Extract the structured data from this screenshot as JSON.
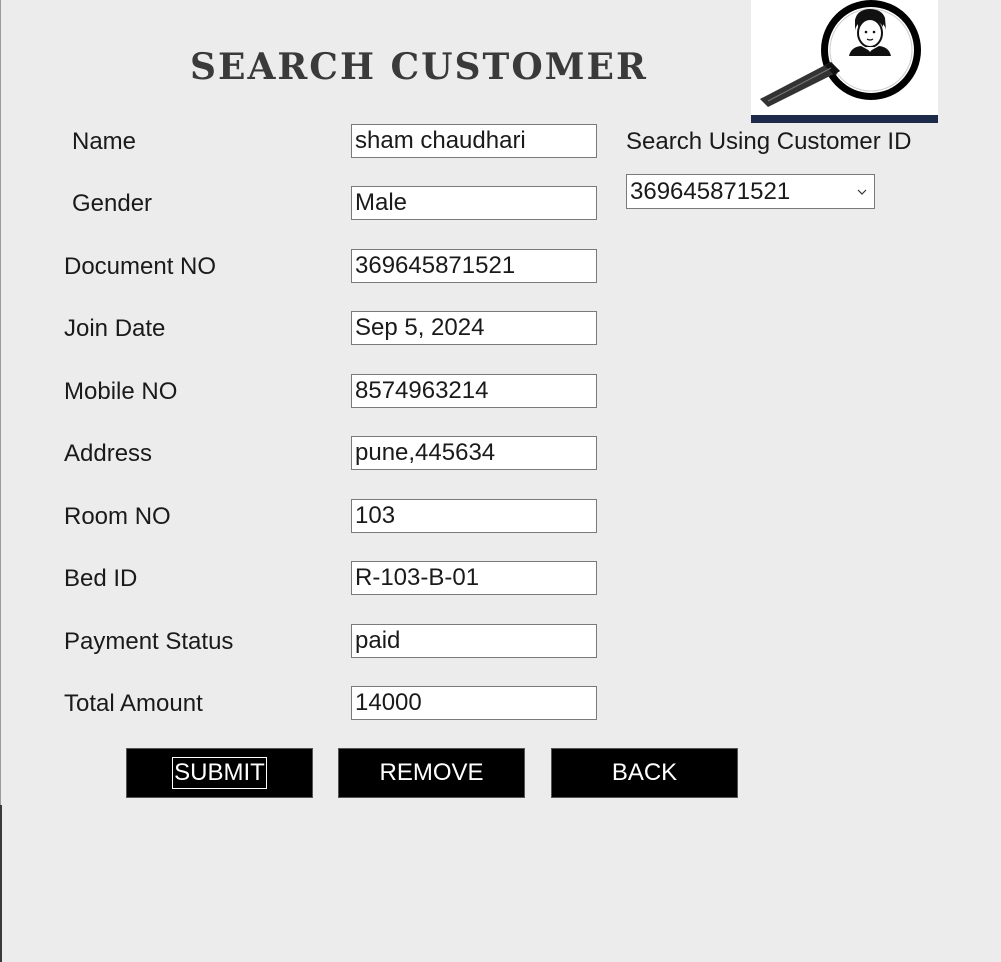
{
  "window": {
    "title": "SEARCH CUSTOMER"
  },
  "form": {
    "fields": [
      {
        "label": "Name",
        "value": "sham chaudhari"
      },
      {
        "label": "Gender",
        "value": "Male"
      },
      {
        "label": "Document NO",
        "value": "369645871521"
      },
      {
        "label": "Join Date",
        "value": "Sep 5, 2024"
      },
      {
        "label": "Mobile NO",
        "value": "8574963214"
      },
      {
        "label": "Address",
        "value": "pune,445634"
      },
      {
        "label": "Room NO",
        "value": "103"
      },
      {
        "label": "Bed ID",
        "value": "R-103-B-01"
      },
      {
        "label": "Payment Status",
        "value": "paid"
      },
      {
        "label": "Total Amount",
        "value": "14000"
      }
    ]
  },
  "search": {
    "label": "Search Using Customer ID",
    "selected": "369645871521"
  },
  "buttons": {
    "submit": "SUBMIT",
    "remove": "REMOVE",
    "back": "BACK"
  },
  "icons": {
    "logo": "magnifier-user-icon",
    "dropdown": "chevron-down-icon"
  },
  "colors": {
    "background": "#ececec",
    "button_bg": "#000000",
    "button_text": "#ffffff",
    "title": "#3a3a3a"
  }
}
